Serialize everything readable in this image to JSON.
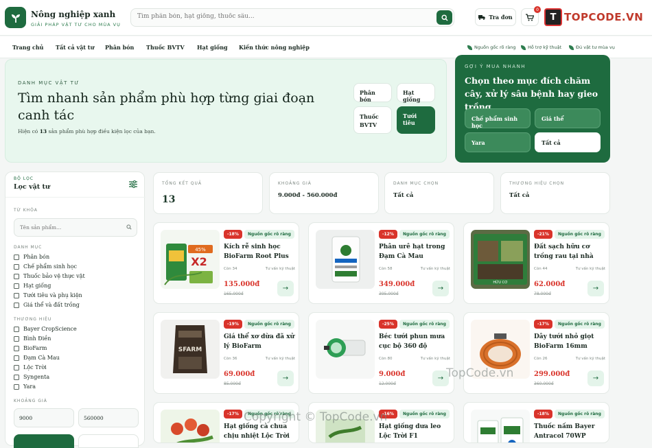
{
  "brand": {
    "name": "Nông nghiệp xanh",
    "tagline": "GIẢI PHÁP VẬT TƯ CHO MÙA VỤ"
  },
  "search": {
    "placeholder": "Tìm phân bón, hạt giống, thuốc sâu..."
  },
  "header": {
    "track_label": "Tra đơn",
    "cart_count": "0"
  },
  "watermark": {
    "logo_text": "TOPCODE.VN",
    "logo_mark": "T",
    "center": "TopCode.vn",
    "bottom": "Copyright © TopCode.vn"
  },
  "nav": {
    "items": [
      "Trang chủ",
      "Tất cả vật tư",
      "Phân bón",
      "Thuốc BVTV",
      "Hạt giống",
      "Kiến thức nông nghiệp"
    ],
    "trust": [
      "Nguồn gốc rõ ràng",
      "Hỗ trợ kỹ thuật",
      "Đủ vật tư mùa vụ"
    ]
  },
  "hero": {
    "kicker": "DANH MỤC VẬT TƯ",
    "title": "Tìm nhanh sản phẩm phù hợp từng giai đoạn canh tác",
    "sub_prefix": "Hiện có ",
    "count": "13",
    "sub_suffix": " sản phẩm phù hợp điều kiện lọc của bạn.",
    "chips": [
      "Phân bón",
      "Hạt giống",
      "Thuốc BVTV",
      "Tưới tiêu"
    ]
  },
  "quick": {
    "kicker": "GỢI Ý MUA NHANH",
    "title": "Chọn theo mục đích chăm cây, xử lý sâu bệnh hay gieo trồng",
    "buttons": [
      "Chế phẩm sinh học",
      "Giá thể",
      "Yara",
      "Tất cả"
    ]
  },
  "sidebar": {
    "kicker": "BỘ LỌC",
    "title": "Lọc vật tư",
    "keyword_label": "TỪ KHÓA",
    "keyword_placeholder": "Tên sản phẩm...",
    "category_label": "DANH MỤC",
    "categories": [
      "Phân bón",
      "Chế phẩm sinh học",
      "Thuốc bảo vệ thực vật",
      "Hạt giống",
      "Tưới tiêu và phụ kiện",
      "Giá thể và đất trồng"
    ],
    "brand_label": "THƯƠNG HIỆU",
    "brands": [
      "Bayer CropScience",
      "Bình Điền",
      "BioFarm",
      "Đạm Cà Mau",
      "Lộc Trời",
      "Syngenta",
      "Yara"
    ],
    "price_label": "KHOẢNG GIÁ",
    "price_min": "9000",
    "price_max": "560000"
  },
  "stats": [
    {
      "label": "TỔNG KẾT QUẢ",
      "value": "13"
    },
    {
      "label": "KHOẢNG GIÁ",
      "value": "9.000đ - 560.000đ"
    },
    {
      "label": "DANH MỤC CHỌN",
      "value": "Tất cả"
    },
    {
      "label": "THƯƠNG HIỆU CHỌN",
      "value": "Tất cả"
    }
  ],
  "products": [
    {
      "discount": "-18%",
      "origin": "Nguồn gốc rõ ràng",
      "name": "Kích rễ sinh học BioFarm Root Plus",
      "stock": "Còn 34",
      "support": "Tư vấn kỹ thuật",
      "price": "135.000đ",
      "old_price": "165.000đ"
    },
    {
      "discount": "-12%",
      "origin": "Nguồn gốc rõ ràng",
      "name": "Phân urê hạt trong Đạm Cà Mau",
      "stock": "Còn 58",
      "support": "Tư vấn kỹ thuật",
      "price": "349.000đ",
      "old_price": "395.000đ"
    },
    {
      "discount": "-21%",
      "origin": "Nguồn gốc rõ ràng",
      "name": "Đất sạch hữu cơ trồng rau tại nhà",
      "stock": "Còn 44",
      "support": "Tư vấn kỹ thuật",
      "price": "62.000đ",
      "old_price": "78.000đ"
    },
    {
      "discount": "-19%",
      "origin": "Nguồn gốc rõ ràng",
      "name": "Giá thể xơ dừa đã xử lý BioFarm",
      "stock": "Còn 36",
      "support": "Tư vấn kỹ thuật",
      "price": "69.000đ",
      "old_price": "85.000đ"
    },
    {
      "discount": "-25%",
      "origin": "Nguồn gốc rõ ràng",
      "name": "Béc tưới phun mưa cục bộ 360 độ",
      "stock": "Còn 80",
      "support": "Tư vấn kỹ thuật",
      "price": "9.000đ",
      "old_price": "12.000đ"
    },
    {
      "discount": "-17%",
      "origin": "Nguồn gốc rõ ràng",
      "name": "Dây tưới nhỏ giọt BioFarm 16mm",
      "stock": "Còn 26",
      "support": "Tư vấn kỹ thuật",
      "price": "299.000đ",
      "old_price": "360.000đ"
    },
    {
      "discount": "-17%",
      "origin": "Nguồn gốc rõ ràng",
      "name": "Hạt giống cà chua chịu nhiệt Lộc Trời",
      "stock": "",
      "support": "",
      "price": "",
      "old_price": ""
    },
    {
      "discount": "-16%",
      "origin": "Nguồn gốc rõ ràng",
      "name": "Hạt giống dưa leo Lộc Trời F1",
      "stock": "",
      "support": "",
      "price": "",
      "old_price": ""
    },
    {
      "discount": "-18%",
      "origin": "Nguồn gốc rõ ràng",
      "name": "Thuốc nấm Bayer Antracol 70WP",
      "stock": "",
      "support": "",
      "price": "",
      "old_price": ""
    }
  ],
  "colors": {
    "primary": "#1e6b3f",
    "hero_bg": "#e8f7ee",
    "sale": "#d9342b"
  }
}
